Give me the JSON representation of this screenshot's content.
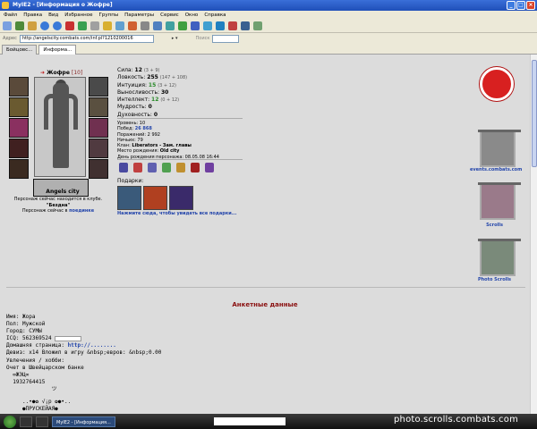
{
  "window": {
    "title": "MyIE2 - [Информация о Жофре]"
  },
  "menu": [
    "Файл",
    "Правка",
    "Вид",
    "Избранное",
    "Группы",
    "Параметры",
    "Сервис",
    "Окно",
    "Справка"
  ],
  "address": {
    "label": "Адрес",
    "url": "http://angelscity.combats.com/inf.pl?1210200016",
    "go_label": "",
    "search_label": "Поиск"
  },
  "tabs": [
    {
      "label": "Бойцовс..."
    },
    {
      "label": "Информа..."
    }
  ],
  "character": {
    "name": "Жофре",
    "level": "[10]",
    "city": "Angels city",
    "club_line": "Персонаж сейчас находится в клубе.",
    "club_name": "\"Бездна\"",
    "location_prefix": "Персонаж сейчас в",
    "location_link": "поединке"
  },
  "stats": [
    {
      "label": "Сила:",
      "value": "12",
      "extra": "(3 + 9)",
      "color": ""
    },
    {
      "label": "Ловкость:",
      "value": "255",
      "extra": "(147 + 108)",
      "color": ""
    },
    {
      "label": "Интуиция:",
      "value": "15",
      "extra": "(3 + 12)",
      "color": "green"
    },
    {
      "label": "Выносливость:",
      "value": "30",
      "extra": "",
      "color": ""
    },
    {
      "label": "Интеллект:",
      "value": "12",
      "extra": "(0 + 12)",
      "color": "green"
    },
    {
      "label": "Мудрость:",
      "value": "0",
      "extra": "",
      "color": ""
    },
    {
      "label": "Духовность:",
      "value": "0",
      "extra": "",
      "color": ""
    }
  ],
  "info": {
    "level": "Уровень: 10",
    "wins_label": "Побед:",
    "wins": "26 868",
    "losses": "Поражений: 2 992",
    "draws": "Ничьих: 79",
    "clan_label": "Клан:",
    "clan": "Liberators - Зам. главы",
    "birthplace_label": "Место рождения:",
    "birthplace": "Old city",
    "birthday": "День рождения персонажа: 08.05.08 16:44"
  },
  "gifts": {
    "label": "Подарки:",
    "link": "Нажмите сюда, чтобы увидеть все подарки..."
  },
  "side_links": [
    {
      "caption": "events.combats.com",
      "icon": "red-circle-logo"
    },
    {
      "caption": "Scrolls",
      "icon": "scroll-banner-icon"
    },
    {
      "caption": "Photo Scrolls",
      "icon": "photo-banner-icon"
    }
  ],
  "profile": {
    "section_title": "Анкетные данные",
    "name_line": "Имя: Жора",
    "sex_line": "Пол: Мужской",
    "city_line": "Город: СУМЫ",
    "icq_line": "ICQ: 562369524",
    "homepage_label": "Домашняя страница:",
    "homepage_link": "http://........",
    "motto_line": "Девиз: x14 Вложил в игру &nbsp;евров: &nbsp;0.00",
    "hobby_line": "Увлечения / хобби:",
    "hobby_text": "Очет в Швейцарском банке",
    "line_a": "  ∞ЖЭЦ∞",
    "line_b": "  1932764415",
    "line_c": "              ツ",
    "line_d": "     ..•●✿ √¡p ✿●•..",
    "line_e": "     ●ПРУСКЕЙАЯ●"
  },
  "taskbar": {
    "task_label": "MyIE2 - [Информация..."
  },
  "watermark": "photo.scrolls.combats.com"
}
